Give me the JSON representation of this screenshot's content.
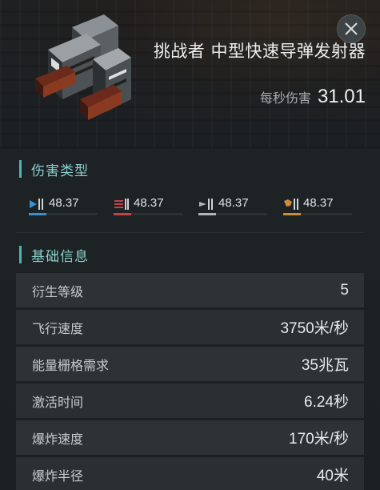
{
  "header": {
    "title": "挑战者 中型快速导弹发射器",
    "dps_label": "每秒伤害",
    "dps_value": "31.01",
    "icon": "missile-launcher-icon",
    "close_icon": "close-icon"
  },
  "damage_section": {
    "title": "伤害类型",
    "types": [
      {
        "icon": "em-damage-icon",
        "value": "48.37",
        "color": "#3a8fd0",
        "fill": 0.25
      },
      {
        "icon": "thermal-damage-icon",
        "value": "48.37",
        "color": "#c2434a",
        "fill": 0.25
      },
      {
        "icon": "kinetic-damage-icon",
        "value": "48.37",
        "color": "#aeb6bb",
        "fill": 0.25
      },
      {
        "icon": "explosive-damage-icon",
        "value": "48.37",
        "color": "#d08a3a",
        "fill": 0.25
      }
    ]
  },
  "info_section": {
    "title": "基础信息",
    "rows": [
      {
        "label": "衍生等级",
        "value": "5"
      },
      {
        "label": "飞行速度",
        "value": "3750米/秒"
      },
      {
        "label": "能量栅格需求",
        "value": "35兆瓦"
      },
      {
        "label": "激活时间",
        "value": "6.24秒"
      },
      {
        "label": "爆炸速度",
        "value": "170米/秒"
      },
      {
        "label": "爆炸半径",
        "value": "40米"
      }
    ]
  },
  "colors": {
    "accent": "#4fb3b0",
    "background": "#1d2225"
  }
}
